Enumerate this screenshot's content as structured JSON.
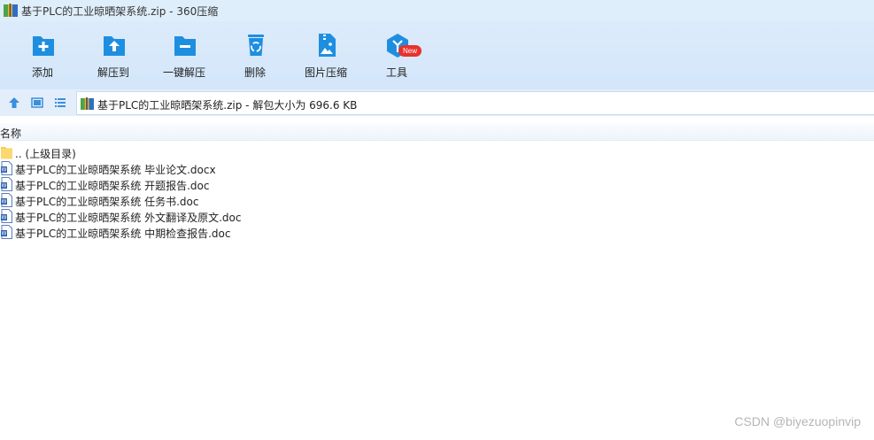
{
  "window": {
    "title": "基于PLC的工业晾晒架系统.zip - 360压缩"
  },
  "toolbar": {
    "items": [
      {
        "label": "添加",
        "icon": "add-folder-icon"
      },
      {
        "label": "解压到",
        "icon": "extract-to-icon"
      },
      {
        "label": "一键解压",
        "icon": "one-click-extract-icon"
      },
      {
        "label": "删除",
        "icon": "recycle-delete-icon"
      },
      {
        "label": "图片压缩",
        "icon": "image-compress-icon"
      },
      {
        "label": "工具",
        "icon": "tools-cube-icon"
      }
    ],
    "new_badge": "New"
  },
  "address_bar": {
    "path": "基于PLC的工业晾晒架系统.zip - 解包大小为 696.6 KB"
  },
  "file_list": {
    "column_name": "名称",
    "rows": [
      {
        "name": ".. (上级目录)",
        "type": "folder"
      },
      {
        "name": "基于PLC的工业晾晒架系统 毕业论文.docx",
        "type": "word"
      },
      {
        "name": "基于PLC的工业晾晒架系统 开题报告.doc",
        "type": "word"
      },
      {
        "name": "基于PLC的工业晾晒架系统 任务书.doc",
        "type": "word"
      },
      {
        "name": "基于PLC的工业晾晒架系统 外文翻译及原文.doc",
        "type": "word"
      },
      {
        "name": "基于PLC的工业晾晒架系统 中期检查报告.doc",
        "type": "word"
      }
    ]
  },
  "watermark": "CSDN @biyezuopinvip",
  "colors": {
    "accent_blue": "#1e8fe0",
    "toolbar_bg": "#d8e8fa",
    "badge_red": "#e8322d"
  }
}
